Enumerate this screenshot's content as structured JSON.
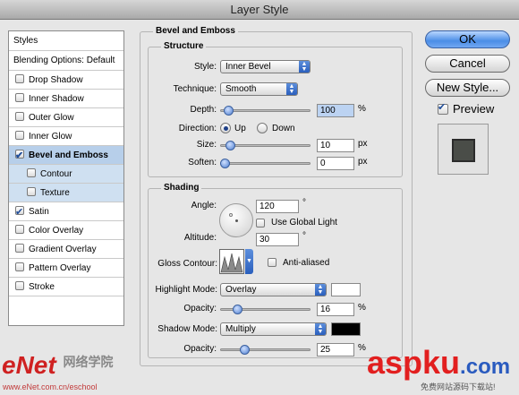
{
  "window": {
    "title": "Layer Style"
  },
  "styles_list": {
    "header": "Styles",
    "items": [
      {
        "label": "Blending Options: Default",
        "checkbox": false,
        "selected": false,
        "sub": false,
        "checked": false
      },
      {
        "label": "Drop Shadow",
        "checkbox": true,
        "checked": false
      },
      {
        "label": "Inner Shadow",
        "checkbox": true,
        "checked": false
      },
      {
        "label": "Outer Glow",
        "checkbox": true,
        "checked": false
      },
      {
        "label": "Inner Glow",
        "checkbox": true,
        "checked": false
      },
      {
        "label": "Bevel and Emboss",
        "checkbox": true,
        "checked": true,
        "selected": true
      },
      {
        "label": "Contour",
        "checkbox": true,
        "checked": false,
        "sub": true
      },
      {
        "label": "Texture",
        "checkbox": true,
        "checked": false,
        "sub": true
      },
      {
        "label": "Satin",
        "checkbox": true,
        "checked": true
      },
      {
        "label": "Color Overlay",
        "checkbox": true,
        "checked": false
      },
      {
        "label": "Gradient Overlay",
        "checkbox": true,
        "checked": false
      },
      {
        "label": "Pattern Overlay",
        "checkbox": true,
        "checked": false
      },
      {
        "label": "Stroke",
        "checkbox": true,
        "checked": false
      }
    ]
  },
  "bevel": {
    "title": "Bevel and Emboss",
    "structure": {
      "title": "Structure",
      "style_label": "Style:",
      "style_value": "Inner Bevel",
      "technique_label": "Technique:",
      "technique_value": "Smooth",
      "depth_label": "Depth:",
      "depth_value": "100",
      "depth_unit": "%",
      "depth_level": 0.05,
      "direction_label": "Direction:",
      "up_label": "Up",
      "down_label": "Down",
      "direction": "Up",
      "size_label": "Size:",
      "size_value": "10",
      "size_unit": "px",
      "size_level": 0.07,
      "soften_label": "Soften:",
      "soften_value": "0",
      "soften_unit": "px",
      "soften_level": 0
    },
    "shading": {
      "title": "Shading",
      "angle_label": "Angle:",
      "angle_value": "120",
      "degree": "°",
      "global_light_label": "Use Global Light",
      "global_light": false,
      "altitude_label": "Altitude:",
      "altitude_value": "30",
      "gloss_label": "Gloss Contour:",
      "anti_alias_label": "Anti-aliased",
      "anti_alias": false,
      "highlight_label": "Highlight Mode:",
      "highlight_value": "Overlay",
      "highlight_color": "#ffffff",
      "hl_opacity_label": "Opacity:",
      "hl_opacity_value": "16",
      "hl_opacity_unit": "%",
      "hl_opacity_level": 0.16,
      "shadow_label": "Shadow Mode:",
      "shadow_value": "Multiply",
      "shadow_color": "#000000",
      "sh_opacity_label": "Opacity:",
      "sh_opacity_value": "25",
      "sh_opacity_unit": "%",
      "sh_opacity_level": 0.25
    }
  },
  "buttons": {
    "ok": "OK",
    "cancel": "Cancel",
    "new_style": "New Style...",
    "preview": "Preview",
    "preview_checked": true
  },
  "colors": {
    "preview_swatch": "#4a4d48",
    "accent": "#4b8de6"
  },
  "watermarks": {
    "left_logo": "eNet",
    "left_cn": "网络学院",
    "left_url": "www.eNet.com.cn/eschool",
    "right_logo": "aspku",
    "right_suffix": ".com",
    "right_sub": "免费网站源码下载站!"
  }
}
